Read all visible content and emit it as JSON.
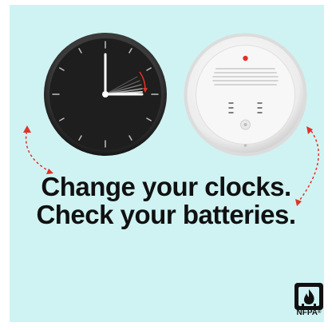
{
  "headline": {
    "line1": "Change your clocks.",
    "line2": "Check your batteries."
  },
  "logo": {
    "text": "NFPA",
    "trademark": "®"
  },
  "icons": {
    "clock": "wall-clock-icon",
    "detector": "smoke-detector-icon",
    "left_arrow": "curved-arrow-icon",
    "right_arrow": "curved-arrow-icon",
    "logo": "nfpa-logo-icon"
  },
  "colors": {
    "background": "#cff3f2",
    "accent_red": "#e0322a",
    "text": "#111111",
    "clock_face": "#1e1e1e",
    "detector": "#f2f2f2"
  }
}
